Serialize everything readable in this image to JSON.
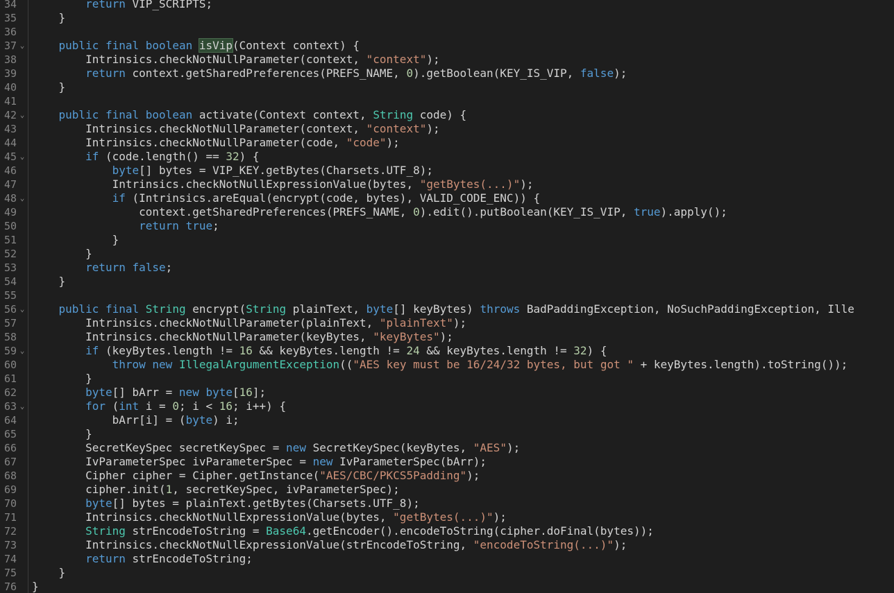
{
  "editor": {
    "lines": [
      {
        "n": "34",
        "fold": false,
        "tokens": [
          [
            "t",
            "        "
          ],
          [
            "kw",
            "return"
          ],
          [
            "t",
            " VIP_SCRIPTS;"
          ]
        ]
      },
      {
        "n": "35",
        "fold": false,
        "tokens": [
          [
            "t",
            "    }"
          ]
        ]
      },
      {
        "n": "36",
        "fold": false,
        "tokens": []
      },
      {
        "n": "37",
        "fold": true,
        "tokens": [
          [
            "t",
            "    "
          ],
          [
            "kw",
            "public"
          ],
          [
            "t",
            " "
          ],
          [
            "kw",
            "final"
          ],
          [
            "t",
            " "
          ],
          [
            "kw",
            "boolean"
          ],
          [
            "t",
            " "
          ],
          [
            "cursor",
            ""
          ],
          [
            "hl",
            "isVip"
          ],
          [
            "t",
            "(Context context) {"
          ]
        ]
      },
      {
        "n": "38",
        "fold": false,
        "tokens": [
          [
            "t",
            "        Intrinsics.checkNotNullParameter(context, "
          ],
          [
            "str",
            "\"context\""
          ],
          [
            "t",
            ");"
          ]
        ]
      },
      {
        "n": "39",
        "fold": false,
        "tokens": [
          [
            "t",
            "        "
          ],
          [
            "kw",
            "return"
          ],
          [
            "t",
            " context.getSharedPreferences(PREFS_NAME, "
          ],
          [
            "num",
            "0"
          ],
          [
            "t",
            ").getBoolean(KEY_IS_VIP, "
          ],
          [
            "kw",
            "false"
          ],
          [
            "t",
            ");"
          ]
        ]
      },
      {
        "n": "40",
        "fold": false,
        "tokens": [
          [
            "t",
            "    }"
          ]
        ]
      },
      {
        "n": "41",
        "fold": false,
        "tokens": []
      },
      {
        "n": "42",
        "fold": true,
        "tokens": [
          [
            "t",
            "    "
          ],
          [
            "kw",
            "public"
          ],
          [
            "t",
            " "
          ],
          [
            "kw",
            "final"
          ],
          [
            "t",
            " "
          ],
          [
            "kw",
            "boolean"
          ],
          [
            "t",
            " activate(Context context, "
          ],
          [
            "typ",
            "String"
          ],
          [
            "t",
            " code) {"
          ]
        ]
      },
      {
        "n": "43",
        "fold": false,
        "tokens": [
          [
            "t",
            "        Intrinsics.checkNotNullParameter(context, "
          ],
          [
            "str",
            "\"context\""
          ],
          [
            "t",
            ");"
          ]
        ]
      },
      {
        "n": "44",
        "fold": false,
        "tokens": [
          [
            "t",
            "        Intrinsics.checkNotNullParameter(code, "
          ],
          [
            "str",
            "\"code\""
          ],
          [
            "t",
            ");"
          ]
        ]
      },
      {
        "n": "45",
        "fold": true,
        "tokens": [
          [
            "t",
            "        "
          ],
          [
            "kw",
            "if"
          ],
          [
            "t",
            " (code.length() == "
          ],
          [
            "num",
            "32"
          ],
          [
            "t",
            ") {"
          ]
        ]
      },
      {
        "n": "46",
        "fold": false,
        "tokens": [
          [
            "t",
            "            "
          ],
          [
            "kw",
            "byte"
          ],
          [
            "t",
            "[] bytes = VIP_KEY.getBytes(Charsets.UTF_8);"
          ]
        ]
      },
      {
        "n": "47",
        "fold": false,
        "tokens": [
          [
            "t",
            "            Intrinsics.checkNotNullExpressionValue(bytes, "
          ],
          [
            "str",
            "\"getBytes(...)\""
          ],
          [
            "t",
            ");"
          ]
        ]
      },
      {
        "n": "48",
        "fold": true,
        "tokens": [
          [
            "t",
            "            "
          ],
          [
            "kw",
            "if"
          ],
          [
            "t",
            " (Intrinsics.areEqual(encrypt(code, bytes), VALID_CODE_ENC)) {"
          ]
        ]
      },
      {
        "n": "49",
        "fold": false,
        "tokens": [
          [
            "t",
            "                context.getSharedPreferences(PREFS_NAME, "
          ],
          [
            "num",
            "0"
          ],
          [
            "t",
            ").edit().putBoolean(KEY_IS_VIP, "
          ],
          [
            "kw",
            "true"
          ],
          [
            "t",
            ").apply();"
          ]
        ]
      },
      {
        "n": "50",
        "fold": false,
        "tokens": [
          [
            "t",
            "                "
          ],
          [
            "kw",
            "return"
          ],
          [
            "t",
            " "
          ],
          [
            "kw",
            "true"
          ],
          [
            "t",
            ";"
          ]
        ]
      },
      {
        "n": "51",
        "fold": false,
        "tokens": [
          [
            "t",
            "            }"
          ]
        ]
      },
      {
        "n": "52",
        "fold": false,
        "tokens": [
          [
            "t",
            "        }"
          ]
        ]
      },
      {
        "n": "53",
        "fold": false,
        "tokens": [
          [
            "t",
            "        "
          ],
          [
            "kw",
            "return"
          ],
          [
            "t",
            " "
          ],
          [
            "kw",
            "false"
          ],
          [
            "t",
            ";"
          ]
        ]
      },
      {
        "n": "54",
        "fold": false,
        "tokens": [
          [
            "t",
            "    }"
          ]
        ]
      },
      {
        "n": "55",
        "fold": false,
        "tokens": []
      },
      {
        "n": "56",
        "fold": true,
        "tokens": [
          [
            "t",
            "    "
          ],
          [
            "kw",
            "public"
          ],
          [
            "t",
            " "
          ],
          [
            "kw",
            "final"
          ],
          [
            "t",
            " "
          ],
          [
            "typ",
            "String"
          ],
          [
            "t",
            " encrypt("
          ],
          [
            "typ",
            "String"
          ],
          [
            "t",
            " plainText, "
          ],
          [
            "kw",
            "byte"
          ],
          [
            "t",
            "[] keyBytes) "
          ],
          [
            "kw",
            "throws"
          ],
          [
            "t",
            " BadPaddingException, NoSuchPaddingException, Ille"
          ]
        ]
      },
      {
        "n": "57",
        "fold": false,
        "tokens": [
          [
            "t",
            "        Intrinsics.checkNotNullParameter(plainText, "
          ],
          [
            "str",
            "\"plainText\""
          ],
          [
            "t",
            ");"
          ]
        ]
      },
      {
        "n": "58",
        "fold": false,
        "tokens": [
          [
            "t",
            "        Intrinsics.checkNotNullParameter(keyBytes, "
          ],
          [
            "str",
            "\"keyBytes\""
          ],
          [
            "t",
            ");"
          ]
        ]
      },
      {
        "n": "59",
        "fold": true,
        "tokens": [
          [
            "t",
            "        "
          ],
          [
            "kw",
            "if"
          ],
          [
            "t",
            " (keyBytes.length != "
          ],
          [
            "num",
            "16"
          ],
          [
            "t",
            " && keyBytes.length != "
          ],
          [
            "num",
            "24"
          ],
          [
            "t",
            " && keyBytes.length != "
          ],
          [
            "num",
            "32"
          ],
          [
            "t",
            ") {"
          ]
        ]
      },
      {
        "n": "60",
        "fold": false,
        "tokens": [
          [
            "t",
            "            "
          ],
          [
            "kw",
            "throw"
          ],
          [
            "t",
            " "
          ],
          [
            "kw",
            "new"
          ],
          [
            "t",
            " "
          ],
          [
            "typ",
            "IllegalArgumentException"
          ],
          [
            "t",
            "(("
          ],
          [
            "str",
            "\"AES key must be 16/24/32 bytes, but got \""
          ],
          [
            "t",
            " + keyBytes.length).toString());"
          ]
        ]
      },
      {
        "n": "61",
        "fold": false,
        "tokens": [
          [
            "t",
            "        }"
          ]
        ]
      },
      {
        "n": "62",
        "fold": false,
        "tokens": [
          [
            "t",
            "        "
          ],
          [
            "kw",
            "byte"
          ],
          [
            "t",
            "[] bArr = "
          ],
          [
            "kw",
            "new"
          ],
          [
            "t",
            " "
          ],
          [
            "kw",
            "byte"
          ],
          [
            "t",
            "["
          ],
          [
            "num",
            "16"
          ],
          [
            "t",
            "];"
          ]
        ]
      },
      {
        "n": "63",
        "fold": true,
        "tokens": [
          [
            "t",
            "        "
          ],
          [
            "kw",
            "for"
          ],
          [
            "t",
            " ("
          ],
          [
            "kw",
            "int"
          ],
          [
            "t",
            " i = "
          ],
          [
            "num",
            "0"
          ],
          [
            "t",
            "; i < "
          ],
          [
            "num",
            "16"
          ],
          [
            "t",
            "; i++) {"
          ]
        ]
      },
      {
        "n": "64",
        "fold": false,
        "tokens": [
          [
            "t",
            "            bArr[i] = ("
          ],
          [
            "kw",
            "byte"
          ],
          [
            "t",
            ") i;"
          ]
        ]
      },
      {
        "n": "65",
        "fold": false,
        "tokens": [
          [
            "t",
            "        }"
          ]
        ]
      },
      {
        "n": "66",
        "fold": false,
        "tokens": [
          [
            "t",
            "        SecretKeySpec secretKeySpec = "
          ],
          [
            "kw",
            "new"
          ],
          [
            "t",
            " SecretKeySpec(keyBytes, "
          ],
          [
            "str",
            "\"AES\""
          ],
          [
            "t",
            ");"
          ]
        ]
      },
      {
        "n": "67",
        "fold": false,
        "tokens": [
          [
            "t",
            "        IvParameterSpec ivParameterSpec = "
          ],
          [
            "kw",
            "new"
          ],
          [
            "t",
            " IvParameterSpec(bArr);"
          ]
        ]
      },
      {
        "n": "68",
        "fold": false,
        "tokens": [
          [
            "t",
            "        Cipher cipher = Cipher.getInstance("
          ],
          [
            "str",
            "\"AES/CBC/PKCS5Padding\""
          ],
          [
            "t",
            ");"
          ]
        ]
      },
      {
        "n": "69",
        "fold": false,
        "tokens": [
          [
            "t",
            "        cipher.init("
          ],
          [
            "num",
            "1"
          ],
          [
            "t",
            ", secretKeySpec, ivParameterSpec);"
          ]
        ]
      },
      {
        "n": "70",
        "fold": false,
        "tokens": [
          [
            "t",
            "        "
          ],
          [
            "kw",
            "byte"
          ],
          [
            "t",
            "[] bytes = plainText.getBytes(Charsets.UTF_8);"
          ]
        ]
      },
      {
        "n": "71",
        "fold": false,
        "tokens": [
          [
            "t",
            "        Intrinsics.checkNotNullExpressionValue(bytes, "
          ],
          [
            "str",
            "\"getBytes(...)\""
          ],
          [
            "t",
            ");"
          ]
        ]
      },
      {
        "n": "72",
        "fold": false,
        "tokens": [
          [
            "t",
            "        "
          ],
          [
            "typ",
            "String"
          ],
          [
            "t",
            " strEncodeToString = "
          ],
          [
            "typ",
            "Base64"
          ],
          [
            "t",
            ".getEncoder().encodeToString(cipher.doFinal(bytes));"
          ]
        ]
      },
      {
        "n": "73",
        "fold": false,
        "tokens": [
          [
            "t",
            "        Intrinsics.checkNotNullExpressionValue(strEncodeToString, "
          ],
          [
            "str",
            "\"encodeToString(...)\""
          ],
          [
            "t",
            ");"
          ]
        ]
      },
      {
        "n": "74",
        "fold": false,
        "tokens": [
          [
            "t",
            "        "
          ],
          [
            "kw",
            "return"
          ],
          [
            "t",
            " strEncodeToString;"
          ]
        ]
      },
      {
        "n": "75",
        "fold": false,
        "tokens": [
          [
            "t",
            "    }"
          ]
        ]
      },
      {
        "n": "76",
        "fold": false,
        "tokens": [
          [
            "t",
            "}"
          ]
        ]
      }
    ]
  }
}
